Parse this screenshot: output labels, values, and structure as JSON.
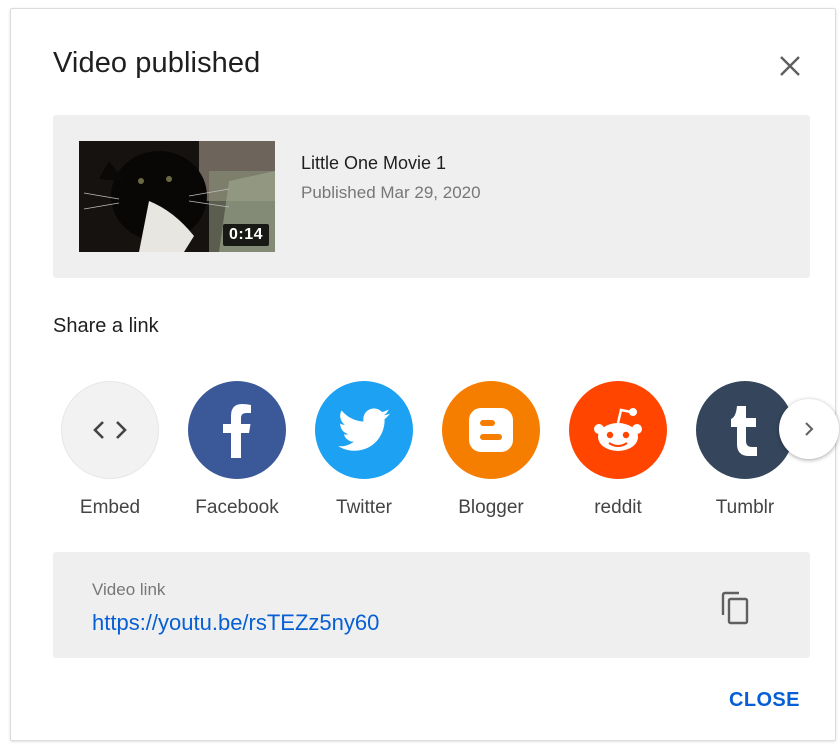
{
  "dialog": {
    "title": "Video published",
    "close_icon": "close-icon"
  },
  "video": {
    "title": "Little One Movie 1",
    "published": "Published Mar 29, 2020",
    "duration": "0:14"
  },
  "share": {
    "heading": "Share a link",
    "items": [
      {
        "label": "Embed",
        "icon": "embed-icon",
        "color": "#f2f2f2"
      },
      {
        "label": "Facebook",
        "icon": "facebook-icon",
        "color": "#3b5998"
      },
      {
        "label": "Twitter",
        "icon": "twitter-icon",
        "color": "#1da1f2"
      },
      {
        "label": "Blogger",
        "icon": "blogger-icon",
        "color": "#f57d00"
      },
      {
        "label": "reddit",
        "icon": "reddit-icon",
        "color": "#ff4500"
      },
      {
        "label": "Tumblr",
        "icon": "tumblr-icon",
        "color": "#35465c"
      }
    ],
    "next_icon": "chevron-right-icon"
  },
  "link": {
    "label": "Video link",
    "url": "https://youtu.be/rsTEZz5ny60",
    "copy_icon": "copy-icon"
  },
  "footer": {
    "close_label": "CLOSE"
  },
  "colors": {
    "accent": "#065fd4",
    "card_bg": "#efefef"
  }
}
